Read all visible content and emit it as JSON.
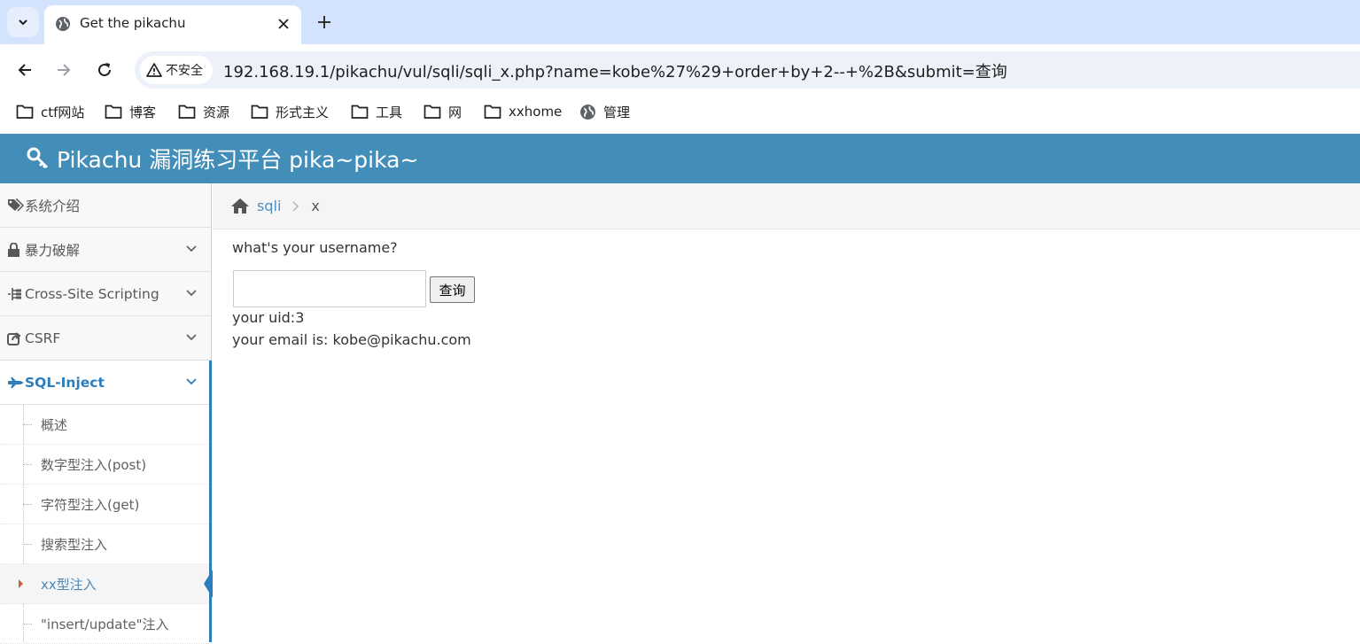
{
  "browser": {
    "tab": {
      "title": "Get the pikachu"
    },
    "address": {
      "security_label": "不安全",
      "url": "192.168.19.1/pikachu/vul/sqli/sqli_x.php?name=kobe%27%29+order+by+2--+%2B&submit=查询"
    },
    "bookmarks": [
      {
        "label": "ctf网站",
        "icon": "folder-icon"
      },
      {
        "label": "博客",
        "icon": "folder-icon"
      },
      {
        "label": "资源",
        "icon": "folder-icon"
      },
      {
        "label": "形式主义",
        "icon": "folder-icon"
      },
      {
        "label": "工具",
        "icon": "folder-icon"
      },
      {
        "label": "网",
        "icon": "folder-icon"
      },
      {
        "label": "xxhome",
        "icon": "folder-icon"
      },
      {
        "label": "管理",
        "icon": "globe-icon"
      }
    ]
  },
  "header": {
    "title": "Pikachu 漏洞练习平台 pika~pika~",
    "accent": "#438eb9"
  },
  "sidebar": {
    "items": [
      {
        "label": "系统介绍",
        "icon": "tags-icon"
      },
      {
        "label": "暴力破解",
        "icon": "lock-icon"
      },
      {
        "label": "Cross-Site Scripting",
        "icon": "sitemap-icon"
      },
      {
        "label": "CSRF",
        "icon": "share-icon"
      },
      {
        "label": "SQL-Inject",
        "icon": "fighter-jet-icon"
      }
    ],
    "submenu": [
      {
        "label": "概述"
      },
      {
        "label": "数字型注入(post)"
      },
      {
        "label": "字符型注入(get)"
      },
      {
        "label": "搜索型注入"
      },
      {
        "label": "xx型注入"
      },
      {
        "label": "\"insert/update\"注入"
      }
    ]
  },
  "breadcrumb": {
    "parent": "sqli",
    "current": "x"
  },
  "main": {
    "question": "what's your username?",
    "input_value": "",
    "submit_label": "查询",
    "result_uid": "your uid:3",
    "result_email": "your email is: kobe@pikachu.com"
  }
}
